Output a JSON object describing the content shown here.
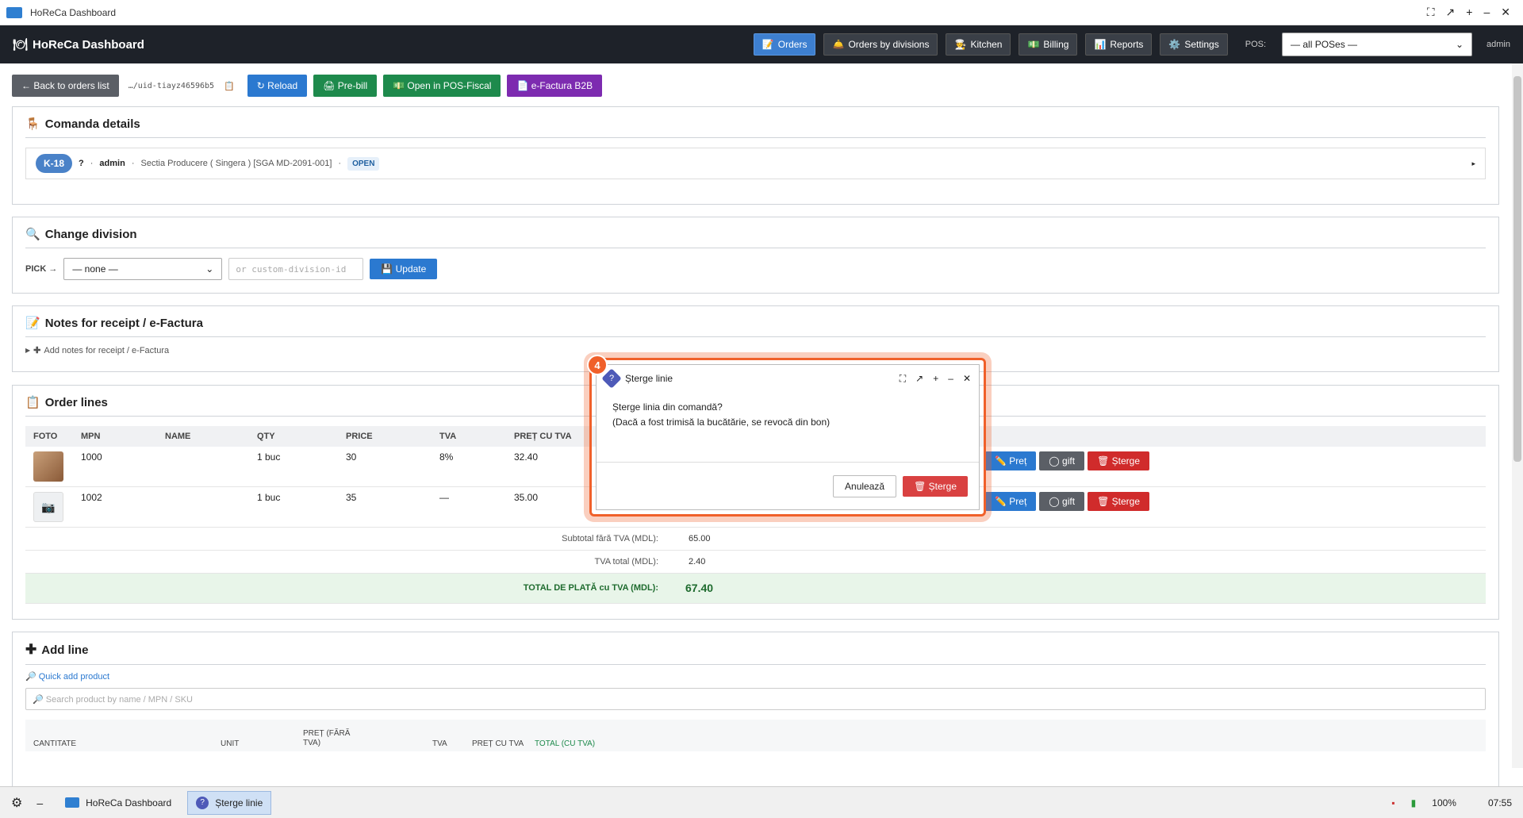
{
  "window": {
    "title": "HoReCa Dashboard"
  },
  "header": {
    "brand": "HoReCa Dashboard",
    "nav": [
      {
        "label": "Orders",
        "icon": "📝"
      },
      {
        "label": "Orders by divisions",
        "icon": "🛎️"
      },
      {
        "label": "Kitchen",
        "icon": "🧑‍🍳"
      },
      {
        "label": "Billing",
        "icon": "💵"
      },
      {
        "label": "Reports",
        "icon": "📊"
      },
      {
        "label": "Settings",
        "icon": "⚙️"
      }
    ],
    "pos_label": "POS:",
    "pos_value": "— all POSes —",
    "user": "admin"
  },
  "toolbar": {
    "back": "← Back to orders list",
    "uid": "…/uid-tiayz46596b5",
    "reload": "↻ Reload",
    "prebill": "🖨 Pre-bill",
    "open_pos": "💵 Open in POS-Fiscal",
    "efactura": "📄 e-Factura B2B"
  },
  "comanda": {
    "title": "Comanda details",
    "table": "K-18",
    "guests": "?",
    "user": "admin",
    "division": "Sectia Producere ( Singera ) [SGA MD-2091-001]",
    "status": "OPEN"
  },
  "division": {
    "title": "Change division",
    "pick": "PICK →",
    "select_value": "— none —",
    "custom_placeholder": "or custom-division-id",
    "update": "💾 Update"
  },
  "notes": {
    "title": "Notes for receipt / e-Factura",
    "toggle": "Add notes for receipt / e-Factura"
  },
  "order_lines": {
    "title": "Order lines",
    "columns": [
      "FOTO",
      "MPN",
      "NAME",
      "QTY",
      "PRICE",
      "TVA",
      "PREȚ CU TVA"
    ],
    "rows": [
      {
        "mpn": "1000",
        "name": "",
        "qty": "1 buc",
        "price": "30",
        "tva": "8%",
        "price_tva": "32.40"
      },
      {
        "mpn": "1002",
        "name": "",
        "qty": "1 buc",
        "price": "35",
        "tva": "—",
        "price_tva": "35.00"
      }
    ],
    "actions": {
      "pret": "✏️ Preț",
      "gift": "◯ gift",
      "sterge": "🗑 Șterge"
    },
    "subtotal_label": "Subtotal fără TVA (MDL):",
    "subtotal": "65.00",
    "tva_label": "TVA total (MDL):",
    "tva": "2.40",
    "total_label": "TOTAL DE PLATĂ cu TVA (MDL):",
    "total": "67.40"
  },
  "add_line": {
    "title": "Add line",
    "quick": "🔎 Quick add product",
    "search_placeholder": "🔎 Search product by name / MPN / SKU",
    "fields": [
      "CANTITATE",
      "UNIT",
      "PREȚ (FĂRĂ TVA)",
      "TVA",
      "PREȚ CU TVA",
      "TOTAL (CU TVA)"
    ]
  },
  "modal": {
    "step": "4",
    "title": "Șterge linie",
    "line1": "Șterge linia din comandă?",
    "line2": "(Dacă a fost trimisă la bucătărie, se revocă din bon)",
    "cancel": "Anulează",
    "delete": "🗑 Șterge"
  },
  "taskbar": {
    "app": "HoReCa Dashboard",
    "dialog": "Șterge linie",
    "battery": "100%",
    "time": "07:55"
  }
}
